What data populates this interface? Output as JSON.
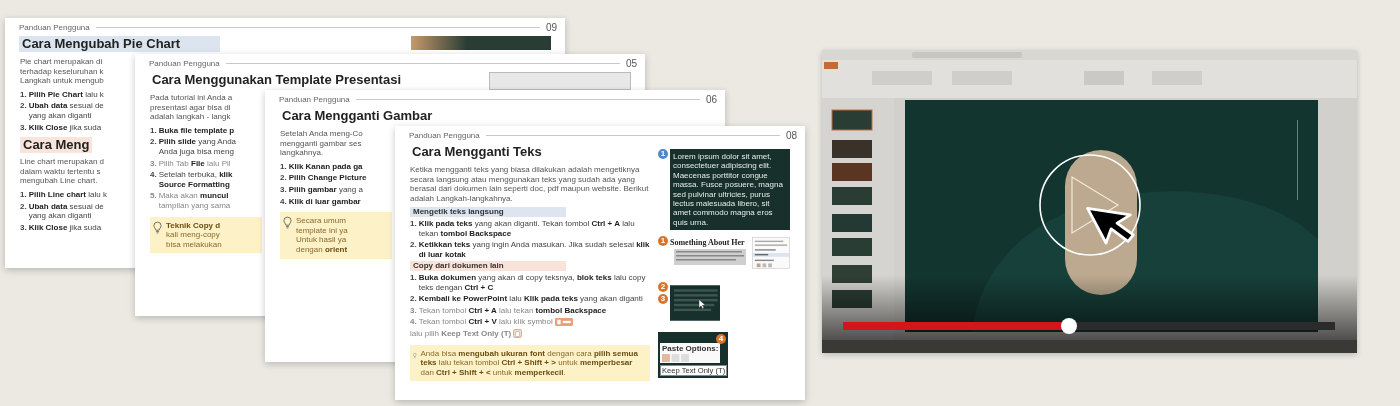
{
  "pages": [
    {
      "header": "Panduan Pengguna",
      "number": "09",
      "title": "Cara Mengubah Pie Chart",
      "title_highlighted": true,
      "thumbnail": {
        "kind": "photo"
      },
      "blocks": [
        {
          "kind": "para",
          "lines": [
            "Pie chart merupakan di",
            "terhadap keseluruhan k",
            "Langkah untuk mengub"
          ]
        },
        {
          "kind": "step",
          "num": "1.",
          "muted": false,
          "lines": [
            "**Pilih Pie Chart** lalu k"
          ]
        },
        {
          "kind": "step",
          "num": "2.",
          "muted": false,
          "lines": [
            "**Ubah data** sesuai de",
            "yang akan diganti"
          ]
        },
        {
          "kind": "step",
          "num": "3.",
          "muted": false,
          "lines": [
            "**Klik Close** jika suda"
          ]
        },
        {
          "kind": "subtitle",
          "text": "Cara Meng",
          "color": "#f8e4da"
        },
        {
          "kind": "para",
          "lines": [
            "Line chart merupakan d",
            "dalam waktu tertentu s",
            "mengubah Line chart."
          ]
        },
        {
          "kind": "step",
          "num": "1.",
          "muted": false,
          "lines": [
            "**Pilih Line chart** lalu k"
          ]
        },
        {
          "kind": "step",
          "num": "2.",
          "muted": false,
          "lines": [
            "**Ubah data** sesuai de",
            "yang akan diganti"
          ]
        },
        {
          "kind": "step",
          "num": "3.",
          "muted": false,
          "lines": [
            "**Klik Close** jika suda"
          ]
        }
      ]
    },
    {
      "header": "Panduan Pengguna",
      "number": "05",
      "title": "Cara Menggunakan Template Presentasi",
      "title_highlighted": false,
      "thumbnail": {
        "kind": "screenshot"
      },
      "blocks": [
        {
          "kind": "para",
          "lines": [
            "Pada tutorial ini Anda a",
            "presentasi agar bisa di",
            "adalah langkah - langk"
          ]
        },
        {
          "kind": "step",
          "num": "1.",
          "muted": false,
          "lines": [
            "**Buka file template p**"
          ]
        },
        {
          "kind": "step",
          "num": "2.",
          "muted": false,
          "lines": [
            "**Pilih slide** yang Anda",
            "Anda juga bisa meng"
          ]
        },
        {
          "kind": "step",
          "num": "3.",
          "muted": true,
          "lines": [
            "Pilih Tab **File** lalu Pil"
          ]
        },
        {
          "kind": "step",
          "num": "4.",
          "muted": false,
          "lines": [
            "Setelah terbuka, **klik**",
            "**Source Formatting**"
          ]
        },
        {
          "kind": "step",
          "num": "5.",
          "muted": true,
          "lines": [
            "Maka akan **muncul**",
            "tampilan yang sama"
          ]
        },
        {
          "kind": "tip",
          "lines": [
            "**Teknik Copy d**",
            "kali meng-copy",
            "bisa melakukan"
          ]
        }
      ]
    },
    {
      "header": "Panduan Pengguna",
      "number": "06",
      "title": "Cara Mengganti Gambar",
      "title_highlighted": false,
      "blocks": [
        {
          "kind": "para",
          "lines": [
            "Setelah Anda meng-Co",
            "mengganti gambar ses",
            "langkahnya."
          ]
        },
        {
          "kind": "step",
          "num": "1.",
          "muted": false,
          "lines": [
            "**Klik Kanan pada ga**"
          ]
        },
        {
          "kind": "step",
          "num": "2.",
          "muted": false,
          "lines": [
            "**Pilih Change Picture**"
          ]
        },
        {
          "kind": "step",
          "num": "3.",
          "muted": false,
          "lines": [
            "**Pilih gambar** yang a"
          ]
        },
        {
          "kind": "step",
          "num": "4.",
          "muted": false,
          "lines": [
            "**Klik di luar gambar**"
          ]
        },
        {
          "kind": "tip",
          "lines": [
            "Secara umum",
            "template ini ya",
            "Untuk hasil ya",
            "dengan **orient**"
          ]
        }
      ]
    },
    {
      "header": "Panduan Pengguna",
      "number": "08",
      "title": "Cara Mengganti Teks",
      "title_highlighted": false,
      "blocks": [
        {
          "kind": "para",
          "lines": [
            "Ketika mengganti teks yang biasa dilakukan adalah mengetiknya secara",
            "langsung atau menggunakan teks yang sudah ada yang berasal dari dokumen",
            "lain seperti doc, pdf maupun website. Berikut adalah Langkah-langkahnya."
          ]
        },
        {
          "kind": "section",
          "text": "Mengetik teks langsung",
          "color": "#dde5f1"
        },
        {
          "kind": "step",
          "num": "1.",
          "muted": false,
          "lines": [
            "**Klik pada teks** yang akan diganti. Tekan tombol **Ctrl + A** lalu tekan",
            "**tombol Backspace**"
          ]
        },
        {
          "kind": "step",
          "num": "2.",
          "muted": false,
          "lines": [
            "**Ketikkan teks** yang ingin Anda masukan. Jika sudah selesai **klik di luar kotak**"
          ]
        },
        {
          "kind": "section",
          "text": "Copy dari dokumen lain",
          "color": "#f9e2d8"
        },
        {
          "kind": "step",
          "num": "1.",
          "muted": false,
          "lines": [
            "**Buka dokumen** yang akan di copy teksnya, **blok teks** lalu copy teks",
            "dengan **Ctrl + C**"
          ]
        },
        {
          "kind": "step",
          "num": "2.",
          "muted": false,
          "lines": [
            "**Kembali ke PowerPoint** lalu **Klik pada teks** yang akan diganti"
          ]
        },
        {
          "kind": "step",
          "num": "3.",
          "muted": true,
          "lines": [
            "Tekan tombol **Ctrl + A** lalu tekan **tombol Backspace**"
          ]
        },
        {
          "kind": "step",
          "num": "4.",
          "muted": true,
          "lines": [
            "Tekan tombol **Ctrl + V** lalu klik symbol"
          ],
          "after_icon": "lalu pilih **Keep Text Only (T)**"
        },
        {
          "kind": "tip",
          "lines": [
            "Anda bisa **mengubah ukuran font** dengan cara **pilih semua teks** lalu",
            "tekan tombol **Ctrl + Shift + >** untuk **memperbesar** dan **Ctrl + Shift + <**",
            "untuk **memperkecil**."
          ]
        }
      ],
      "figures": [
        {
          "kind": "text_slide",
          "badges": [
            {
              "num": "1",
              "color": "#4f86d0"
            }
          ],
          "text": "Lorem ipsum dolor sit amet, consectetuer adipiscing elit. Maecenas porttitor congue massa. Fusce posuere, magna sed pulvinar ultricies, purus lectus malesuada libero, sit amet commodo magna eros quis urna."
        },
        {
          "kind": "doc_snippet",
          "badges": [
            {
              "num": "1",
              "color": "#d9752b"
            }
          ],
          "heading": "Something About Her"
        },
        {
          "kind": "slide_crop",
          "badges": [
            {
              "num": "2",
              "color": "#d9752b"
            },
            {
              "num": "3",
              "color": "#d9752b"
            }
          ]
        },
        {
          "kind": "paste_menu",
          "badges": [
            {
              "num": "4",
              "color": "#d9752b"
            }
          ],
          "menu_title": "Paste Options:",
          "tooltip": "Keep Text Only (T)"
        }
      ]
    }
  ],
  "video": {
    "progress": {
      "level": 0.46
    }
  }
}
